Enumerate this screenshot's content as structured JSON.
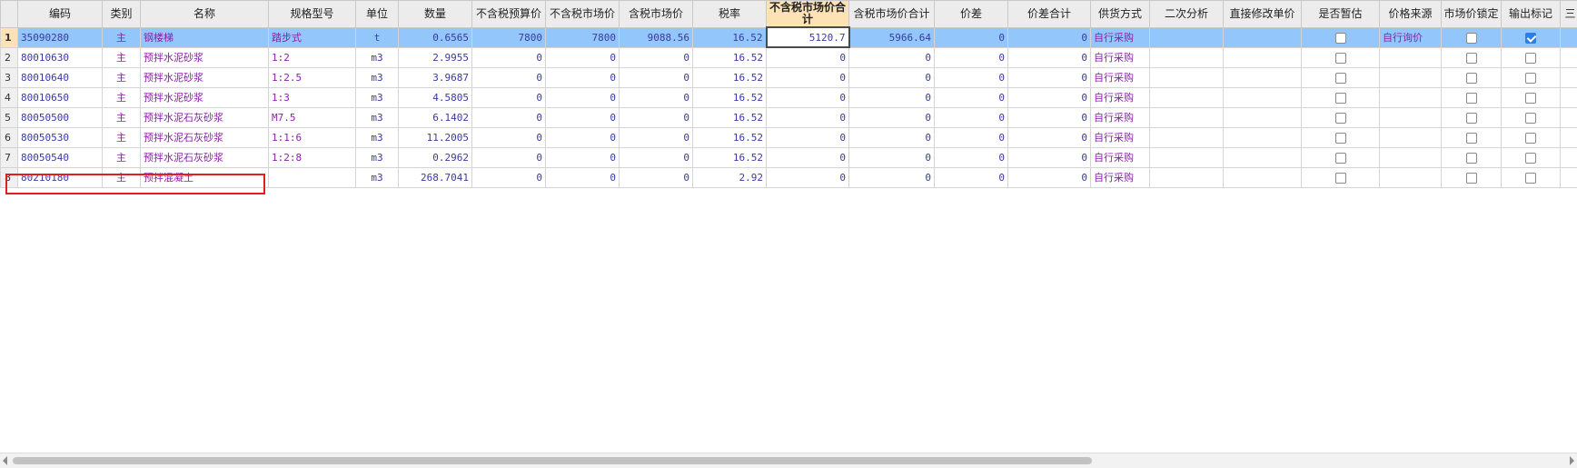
{
  "columns": [
    {
      "key": "rn",
      "label": ""
    },
    {
      "key": "code",
      "label": "编码"
    },
    {
      "key": "type",
      "label": "类别"
    },
    {
      "key": "name",
      "label": "名称"
    },
    {
      "key": "spec",
      "label": "规格型号"
    },
    {
      "key": "unit",
      "label": "单位"
    },
    {
      "key": "qty",
      "label": "数量"
    },
    {
      "key": "budget_ex",
      "label": "不含税预算价"
    },
    {
      "key": "market_ex",
      "label": "不含税市场价"
    },
    {
      "key": "market_in",
      "label": "含税市场价"
    },
    {
      "key": "tax",
      "label": "税率"
    },
    {
      "key": "total_ex",
      "label": "不含税市场价合计"
    },
    {
      "key": "total_in",
      "label": "含税市场价合计"
    },
    {
      "key": "diff",
      "label": "价差"
    },
    {
      "key": "diff_total",
      "label": "价差合计"
    },
    {
      "key": "supply",
      "label": "供货方式"
    },
    {
      "key": "analysis",
      "label": "二次分析"
    },
    {
      "key": "direct",
      "label": "直接修改单价"
    },
    {
      "key": "provisional",
      "label": "是否暂估"
    },
    {
      "key": "source",
      "label": "价格来源"
    },
    {
      "key": "lock",
      "label": "市场价锁定"
    },
    {
      "key": "output",
      "label": "输出标记"
    },
    {
      "key": "extra",
      "label": "三"
    }
  ],
  "rows": [
    {
      "rn": "1",
      "code": "35090280",
      "type": "主",
      "name": "钢楼梯",
      "spec": "踏步式",
      "unit": "t",
      "qty": "0.6565",
      "budget_ex": "7800",
      "market_ex": "7800",
      "market_in": "9088.56",
      "tax": "16.52",
      "total_ex": "5120.7",
      "total_in": "5966.64",
      "diff": "0",
      "diff_total": "0",
      "supply": "自行采购",
      "analysis": "",
      "direct": "",
      "provisional": false,
      "source": "自行询价",
      "lock": false,
      "output": true
    },
    {
      "rn": "2",
      "code": "80010630",
      "type": "主",
      "name": "预拌水泥砂浆",
      "spec": "1:2",
      "unit": "m3",
      "qty": "2.9955",
      "budget_ex": "0",
      "market_ex": "0",
      "market_in": "0",
      "tax": "16.52",
      "total_ex": "0",
      "total_in": "0",
      "diff": "0",
      "diff_total": "0",
      "supply": "自行采购",
      "analysis": "",
      "direct": "",
      "provisional": false,
      "source": "",
      "lock": false,
      "output": false
    },
    {
      "rn": "3",
      "code": "80010640",
      "type": "主",
      "name": "预拌水泥砂浆",
      "spec": "1:2.5",
      "unit": "m3",
      "qty": "3.9687",
      "budget_ex": "0",
      "market_ex": "0",
      "market_in": "0",
      "tax": "16.52",
      "total_ex": "0",
      "total_in": "0",
      "diff": "0",
      "diff_total": "0",
      "supply": "自行采购",
      "analysis": "",
      "direct": "",
      "provisional": false,
      "source": "",
      "lock": false,
      "output": false
    },
    {
      "rn": "4",
      "code": "80010650",
      "type": "主",
      "name": "预拌水泥砂浆",
      "spec": "1:3",
      "unit": "m3",
      "qty": "4.5805",
      "budget_ex": "0",
      "market_ex": "0",
      "market_in": "0",
      "tax": "16.52",
      "total_ex": "0",
      "total_in": "0",
      "diff": "0",
      "diff_total": "0",
      "supply": "自行采购",
      "analysis": "",
      "direct": "",
      "provisional": false,
      "source": "",
      "lock": false,
      "output": false
    },
    {
      "rn": "5",
      "code": "80050500",
      "type": "主",
      "name": "预拌水泥石灰砂浆",
      "spec": "M7.5",
      "unit": "m3",
      "qty": "6.1402",
      "budget_ex": "0",
      "market_ex": "0",
      "market_in": "0",
      "tax": "16.52",
      "total_ex": "0",
      "total_in": "0",
      "diff": "0",
      "diff_total": "0",
      "supply": "自行采购",
      "analysis": "",
      "direct": "",
      "provisional": false,
      "source": "",
      "lock": false,
      "output": false
    },
    {
      "rn": "6",
      "code": "80050530",
      "type": "主",
      "name": "预拌水泥石灰砂浆",
      "spec": "1:1:6",
      "unit": "m3",
      "qty": "11.2005",
      "budget_ex": "0",
      "market_ex": "0",
      "market_in": "0",
      "tax": "16.52",
      "total_ex": "0",
      "total_in": "0",
      "diff": "0",
      "diff_total": "0",
      "supply": "自行采购",
      "analysis": "",
      "direct": "",
      "provisional": false,
      "source": "",
      "lock": false,
      "output": false
    },
    {
      "rn": "7",
      "code": "80050540",
      "type": "主",
      "name": "预拌水泥石灰砂浆",
      "spec": "1:2:8",
      "unit": "m3",
      "qty": "0.2962",
      "budget_ex": "0",
      "market_ex": "0",
      "market_in": "0",
      "tax": "16.52",
      "total_ex": "0",
      "total_in": "0",
      "diff": "0",
      "diff_total": "0",
      "supply": "自行采购",
      "analysis": "",
      "direct": "",
      "provisional": false,
      "source": "",
      "lock": false,
      "output": false
    },
    {
      "rn": "8",
      "code": "80210180",
      "type": "主",
      "name": "预拌混凝土",
      "spec": "",
      "unit": "m3",
      "qty": "268.7041",
      "budget_ex": "0",
      "market_ex": "0",
      "market_in": "0",
      "tax": "2.92",
      "total_ex": "0",
      "total_in": "0",
      "diff": "0",
      "diff_total": "0",
      "supply": "自行采购",
      "analysis": "",
      "direct": "",
      "provisional": false,
      "source": "",
      "lock": false,
      "output": false
    }
  ],
  "colors": {
    "selected_row": "#93c6fb",
    "active_header": "#fde2b6",
    "highlight_box": "#e02020",
    "text_purple": "#8a1fa8",
    "text_blue": "#3a3aa0"
  }
}
